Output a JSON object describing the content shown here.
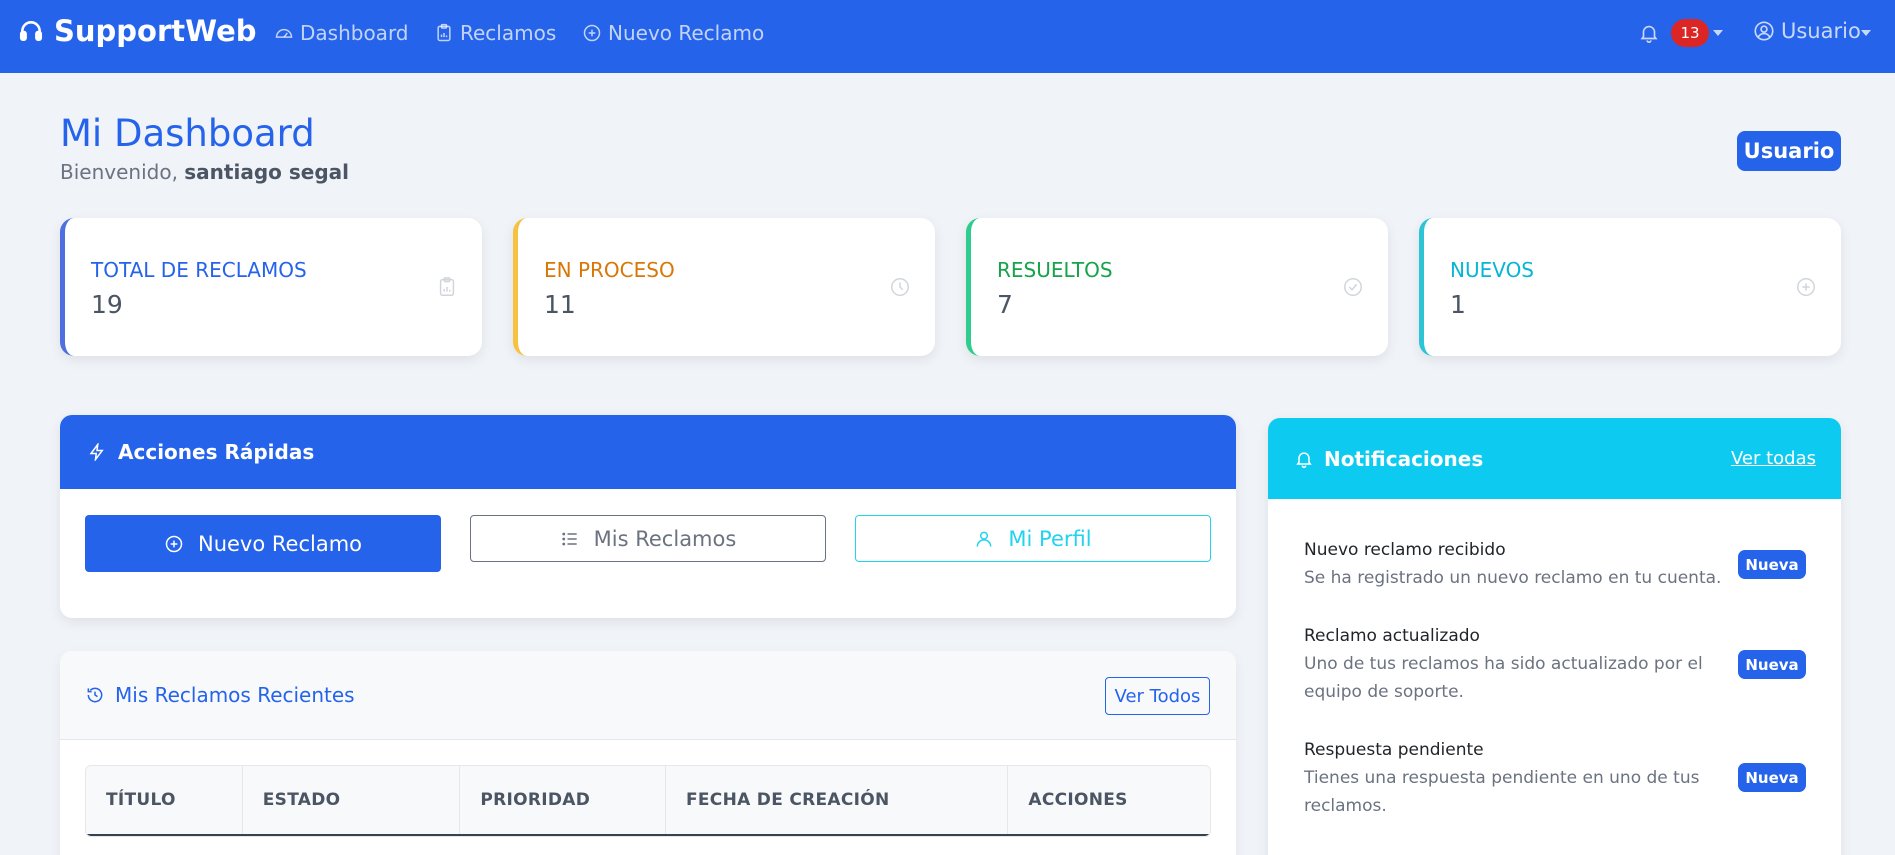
{
  "navbar": {
    "brand": "SupportWeb",
    "links": [
      {
        "label": "Dashboard",
        "icon": "gauge-icon"
      },
      {
        "label": "Reclamos",
        "icon": "clipboard-icon"
      },
      {
        "label": "Nuevo Reclamo",
        "icon": "plus-circle-icon"
      }
    ],
    "notification_count": "13",
    "user_label": "Usuario"
  },
  "header": {
    "title": "Mi Dashboard",
    "welcome_prefix": "Bienvenido,",
    "user_name": "santiago segal",
    "role_badge": "Usuario"
  },
  "stats": [
    {
      "label": "TOTAL DE RECLAMOS",
      "value": "19",
      "color": "#2563eb",
      "icon": "clipboard-icon"
    },
    {
      "label": "EN PROCESO",
      "value": "11",
      "color": "#d97706",
      "icon": "clock-icon"
    },
    {
      "label": "RESUELTOS",
      "value": "7",
      "color": "#16a34a",
      "icon": "check-circle-icon"
    },
    {
      "label": "NUEVOS",
      "value": "1",
      "color": "#06b6d4",
      "icon": "plus-circle-icon"
    }
  ],
  "stat_border_colors": [
    "#4f6fe0",
    "#f5c242",
    "#2ecc8f",
    "#2ec4d6"
  ],
  "quick_actions": {
    "title": "Acciones Rápidas",
    "buttons": [
      "Nuevo Reclamo",
      "Mis Reclamos",
      "Mi Perfil"
    ]
  },
  "recent": {
    "title": "Mis Reclamos Recientes",
    "view_all": "Ver Todos",
    "columns": [
      "TÍTULO",
      "ESTADO",
      "PRIORIDAD",
      "FECHA DE CREACIÓN",
      "ACCIONES"
    ]
  },
  "notifications": {
    "title": "Notificaciones",
    "view_all": "Ver todas",
    "items": [
      {
        "title": "Nuevo reclamo recibido",
        "desc": "Se ha registrado un nuevo reclamo en tu cuenta.",
        "badge": "Nueva"
      },
      {
        "title": "Reclamo actualizado",
        "desc": "Uno de tus reclamos ha sido actualizado por el equipo de soporte.",
        "badge": "Nueva"
      },
      {
        "title": "Respuesta pendiente",
        "desc": "Tienes una respuesta pendiente en uno de tus reclamos.",
        "badge": "Nueva"
      }
    ]
  }
}
